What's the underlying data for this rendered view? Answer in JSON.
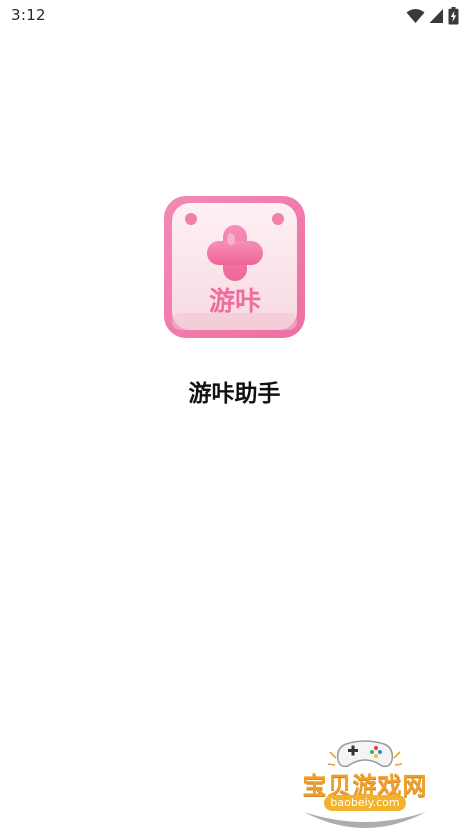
{
  "status_bar": {
    "time": "3:12",
    "icons": [
      "wifi-icon",
      "cell-signal-icon",
      "battery-charging-icon"
    ]
  },
  "splash": {
    "icon_label": "游咔",
    "app_name": "游咔助手"
  },
  "watermark": {
    "title": "宝贝游戏网",
    "url": "baobeiy.com"
  },
  "colors": {
    "icon_pink": "#f27aa9",
    "icon_light": "#fbe9ee",
    "watermark_orange": "#f0a12a",
    "text": "#111111"
  }
}
